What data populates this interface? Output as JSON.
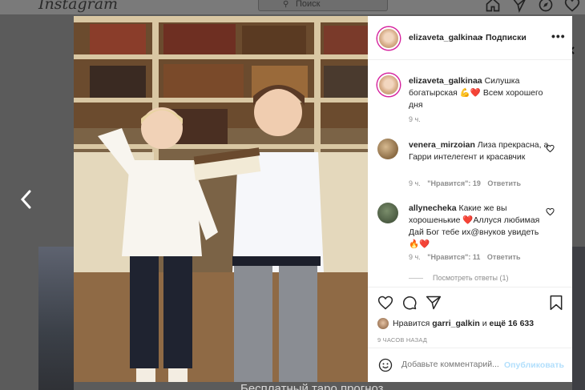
{
  "app": {
    "logo": "Instagram"
  },
  "topbar": {
    "search_placeholder": "Поиск",
    "icons": [
      "home-icon",
      "direct-icon",
      "explore-icon",
      "heart-icon"
    ]
  },
  "background": {
    "caption": "Бесплатный таро прогноз"
  },
  "post": {
    "header": {
      "username": "elizaveta_galkinaa",
      "dot": "•",
      "follow": "Подписки"
    },
    "caption": {
      "username": "elizaveta_galkinaa",
      "text": "Силушка богатырская 💪❤️ Всем хорошего дня",
      "time": "9 ч."
    },
    "comments": [
      {
        "username": "venera_mirzoian",
        "text": "Лиза прекрасна, а Гарри интелегент и красавчик",
        "time": "9 ч.",
        "likes": "\"Нравится\": 19",
        "reply": "Ответить"
      },
      {
        "username": "allynecheka",
        "text": "Какие же вы хорошенькие ❤️Аллуся любимая Дай Бог тебе их@внуков увидеть 🔥❤️",
        "time": "9 ч.",
        "likes": "\"Нравится\": 11",
        "reply": "Ответить",
        "view_replies": "Посмотреть ответы (1)"
      }
    ],
    "likes": {
      "prefix": "Нравится",
      "user": "garri_galkin",
      "suffix": "и",
      "others": "ещё 16 633"
    },
    "posted_ago": "9 ЧАСОВ НАЗАД",
    "add_comment": {
      "placeholder": "Добавьте комментарий...",
      "publish": "Опубликовать"
    }
  },
  "colors": {
    "accent": "#0095f6",
    "publish_disabled": "#b2dffc",
    "heart": "#ed4956",
    "muted": "#8e8e8e"
  }
}
